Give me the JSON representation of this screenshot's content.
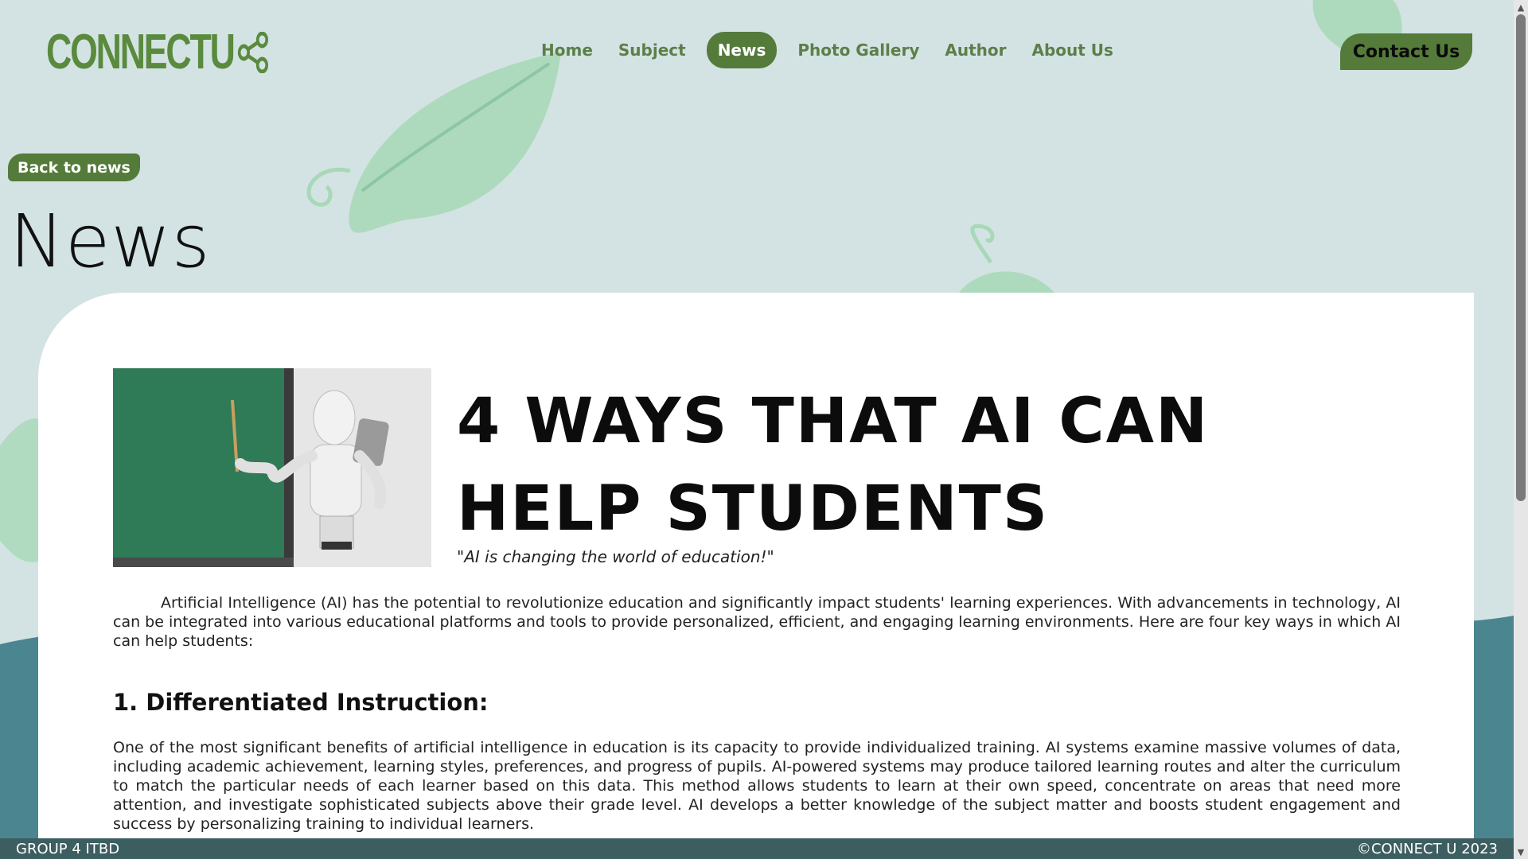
{
  "brand": {
    "logo_text": "CONNECTU"
  },
  "nav": {
    "items": [
      {
        "label": "Home",
        "active": false
      },
      {
        "label": "Subject",
        "active": false
      },
      {
        "label": "News",
        "active": true
      },
      {
        "label": "Photo Gallery",
        "active": false
      },
      {
        "label": "Author",
        "active": false
      },
      {
        "label": "About Us",
        "active": false
      }
    ],
    "contact_label": "Contact Us"
  },
  "page": {
    "back_label": "Back to news",
    "heading": "News"
  },
  "article": {
    "title": "4 WAYS THAT AI CAN HELP STUDENTS",
    "quote": "\"AI is changing the world of education!\"",
    "intro": "Artificial Intelligence (AI) has the potential to revolutionize education and significantly impact students' learning experiences. With advancements in technology, AI can be integrated into various educational platforms and tools to provide personalized, efficient, and engaging learning environments. Here are four key ways in which AI can help students:",
    "section_1_heading": "1. Differentiated Instruction:",
    "section_1_body": "One of the most significant benefits of artificial intelligence in education is its capacity to provide individualized training. AI systems examine massive volumes of data, including academic achievement, learning styles, preferences, and progress of pupils. AI-powered systems may produce tailored learning routes and alter the curriculum to match the particular needs of each learner based on this data. This method allows students to learn at their own speed, concentrate on areas that need more attention, and investigate sophisticated subjects above their grade level. AI develops a better knowledge of the subject matter and boosts student engagement and success by personalizing training to individual learners."
  },
  "footer": {
    "left_text": "GROUP 4 ITBD",
    "right_text": "©CONNECT U 2023"
  },
  "colors": {
    "background": "#d3e3e3",
    "accent": "#547b3a",
    "footer": "#3c5e60",
    "leaf": "#a8d8b8"
  },
  "icons": {
    "logo_share": "share-icon",
    "scroll_up": "scroll-up-arrow",
    "scroll_down": "scroll-down-arrow"
  }
}
